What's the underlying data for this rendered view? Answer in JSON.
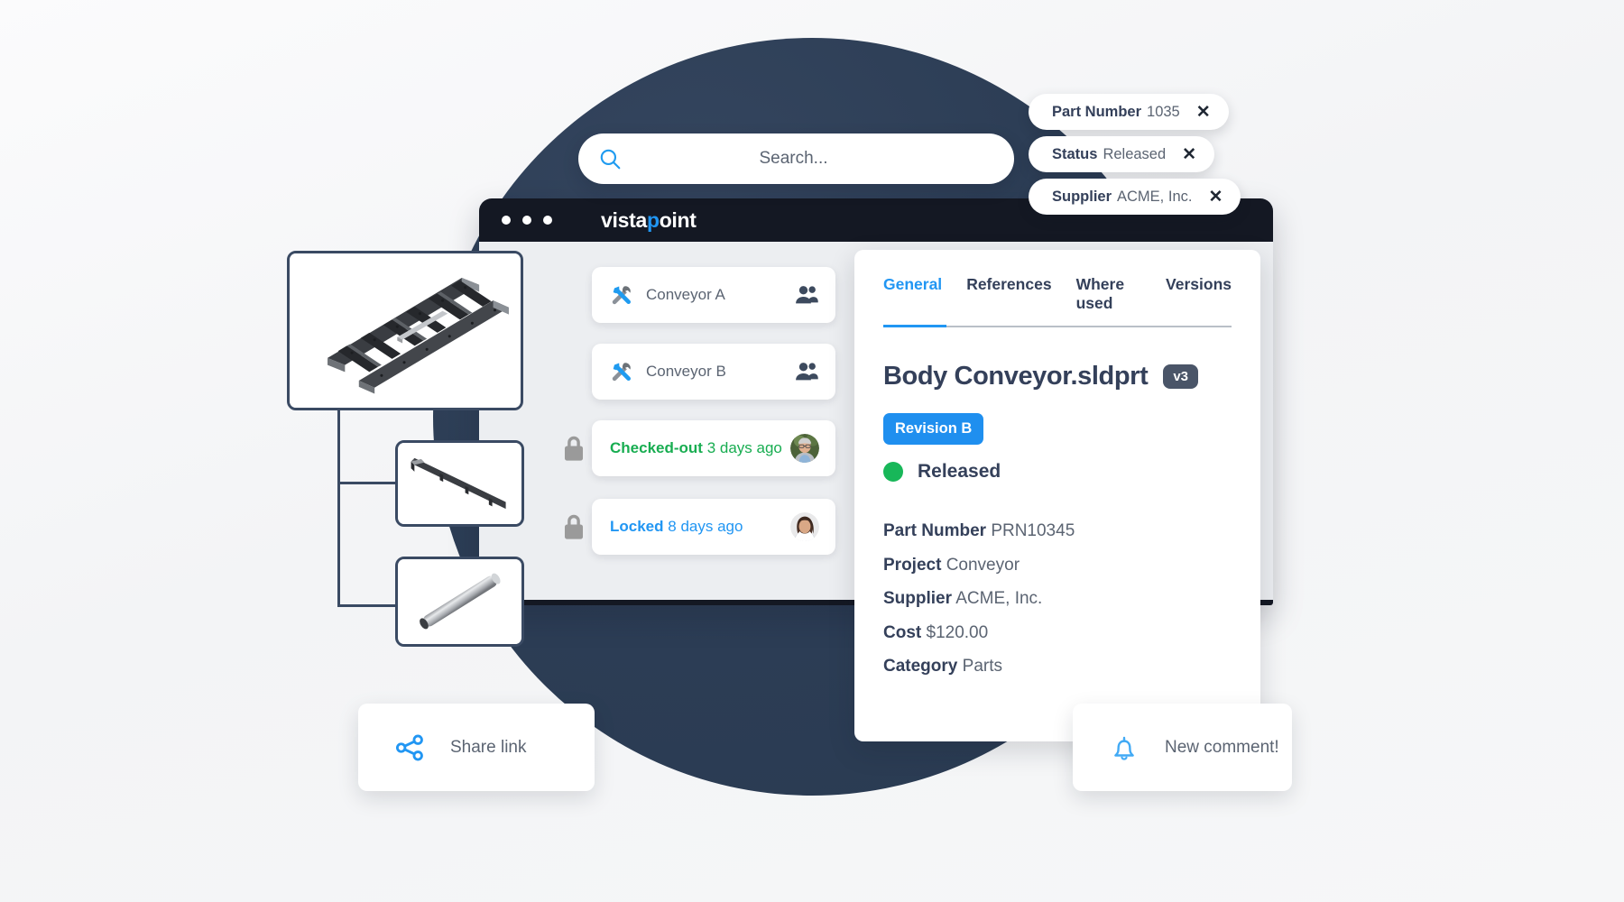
{
  "brand": {
    "name_prefix": "v",
    "name_a": "ista",
    "name_accent": "p",
    "name_b": "oint",
    "full": "vistapoint"
  },
  "search": {
    "placeholder": "Search...",
    "icon": "search-icon"
  },
  "filters": [
    {
      "key": "Part Number",
      "value": "1035",
      "close": "✕"
    },
    {
      "key": "Status",
      "value": "Released",
      "close": "✕"
    },
    {
      "key": "Supplier",
      "value": "ACME, Inc.",
      "close": "✕"
    }
  ],
  "list": {
    "items": [
      {
        "label": "Conveyor A",
        "icon": "tools-icon",
        "right_icon": "people-icon"
      },
      {
        "label": "Conveyor B",
        "icon": "tools-icon",
        "right_icon": "people-icon"
      }
    ],
    "status_rows": [
      {
        "state": "Checked-out",
        "time": "3 days ago",
        "color": "#18ad51",
        "lock_icon": "padlock-icon",
        "avatar": "avatar-male"
      },
      {
        "state": "Locked",
        "time": "8 days ago",
        "color": "#2196f3",
        "lock_icon": "padlock-icon",
        "avatar": "avatar-female"
      }
    ]
  },
  "detail": {
    "tabs": [
      {
        "label": "General",
        "active": true
      },
      {
        "label": "References",
        "active": false
      },
      {
        "label": "Where used",
        "active": false
      },
      {
        "label": "Versions",
        "active": false
      }
    ],
    "title": "Body Conveyor.sldprt",
    "version_badge": "v3",
    "revision_badge": "Revision B",
    "status": "Released",
    "status_color": "#18b759",
    "properties": [
      {
        "key": "Part Number",
        "value": "PRN10345"
      },
      {
        "key": "Project",
        "value": "Conveyor"
      },
      {
        "key": "Supplier",
        "value": "ACME, Inc."
      },
      {
        "key": "Cost",
        "value": "$120.00"
      },
      {
        "key": "Category",
        "value": "Parts"
      }
    ]
  },
  "cards": {
    "share": {
      "label": "Share link",
      "icon": "share-icon"
    },
    "comment": {
      "label": "New comment!",
      "icon": "bell-icon"
    }
  },
  "tree": {
    "nodes": [
      {
        "name": "conveyor-frame-assembly"
      },
      {
        "name": "conveyor-rail-part"
      },
      {
        "name": "conveyor-rod-part"
      }
    ]
  },
  "colors": {
    "accent_blue": "#2196f3",
    "navy": "#2d3e56",
    "dark_title": "#141823",
    "green": "#18b759",
    "text": "#5b6472",
    "heading": "#34405a"
  }
}
